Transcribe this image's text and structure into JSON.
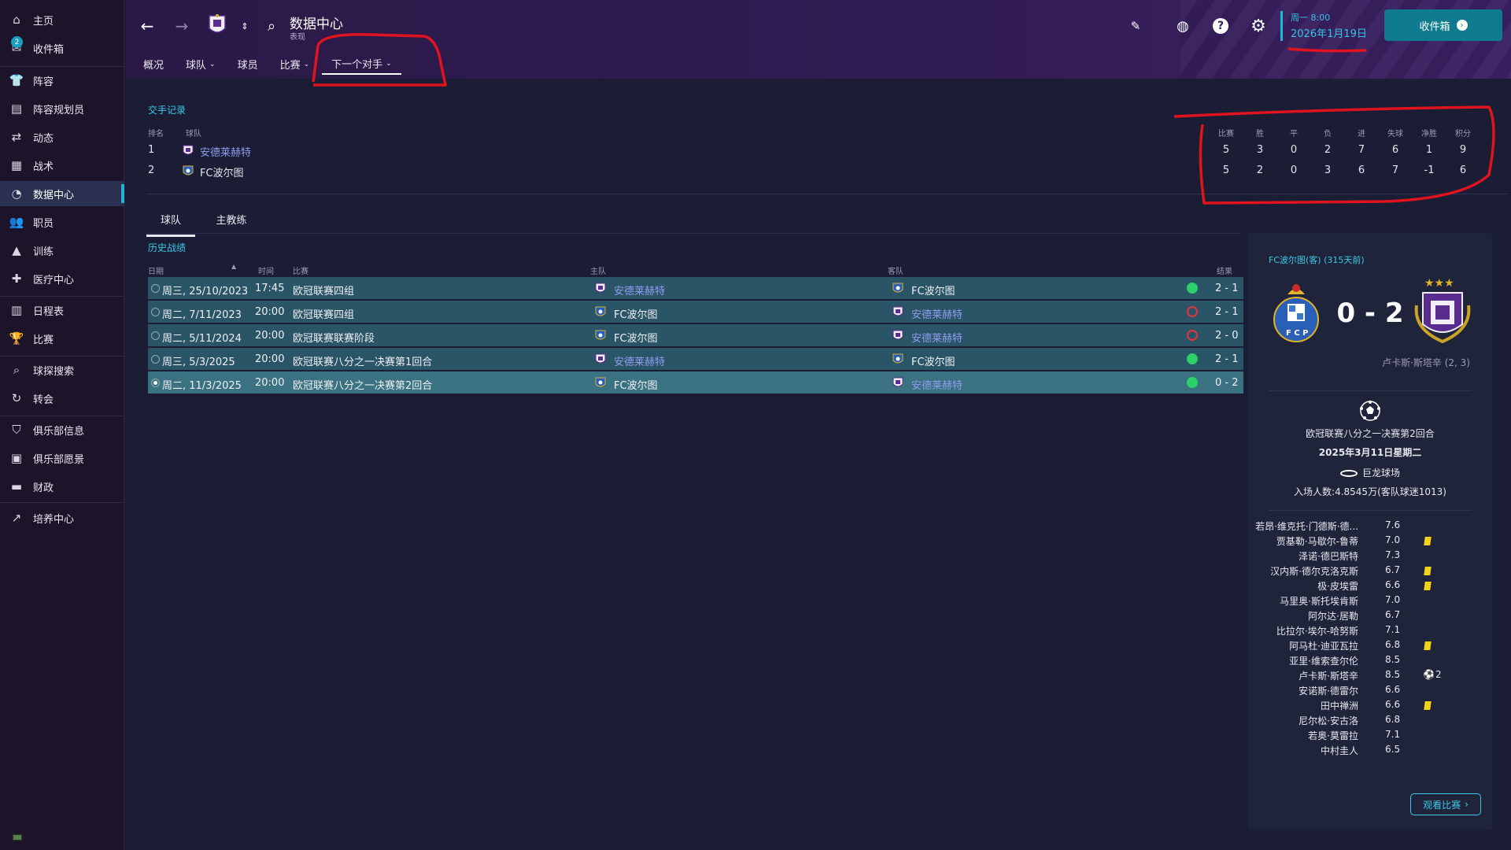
{
  "sidebar": {
    "items": [
      {
        "label": "主页",
        "icon": "home-icon"
      },
      {
        "label": "收件箱",
        "icon": "inbox-icon",
        "badge": "2"
      },
      {
        "label": "阵容",
        "icon": "shirt-icon"
      },
      {
        "label": "阵容规划员",
        "icon": "clipboard-icon"
      },
      {
        "label": "动态",
        "icon": "dynamics-icon"
      },
      {
        "label": "战术",
        "icon": "tactics-icon"
      },
      {
        "label": "数据中心",
        "icon": "data-hub-icon"
      },
      {
        "label": "职员",
        "icon": "staff-icon"
      },
      {
        "label": "训练",
        "icon": "training-icon"
      },
      {
        "label": "医疗中心",
        "icon": "medical-icon"
      },
      {
        "label": "日程表",
        "icon": "calendar-icon"
      },
      {
        "label": "比赛",
        "icon": "trophy-icon"
      },
      {
        "label": "球探搜索",
        "icon": "scouting-icon"
      },
      {
        "label": "转会",
        "icon": "transfers-icon"
      },
      {
        "label": "俱乐部信息",
        "icon": "shield-icon"
      },
      {
        "label": "俱乐部愿景",
        "icon": "vision-icon"
      },
      {
        "label": "财政",
        "icon": "finances-icon"
      },
      {
        "label": "培养中心",
        "icon": "development-icon"
      }
    ],
    "active_label": "数据中心"
  },
  "header": {
    "title": "数据中心",
    "subtitle": "表现",
    "subnav": [
      "概况",
      "球队",
      "球员",
      "比赛",
      "下一个对手"
    ],
    "date_time": "周一 8:00",
    "date": "2026年1月19日",
    "inbox_button": "收件箱"
  },
  "h2h": {
    "section_label": "交手记录",
    "columns_left": [
      "排名",
      "球队"
    ],
    "columns_right": [
      "比赛",
      "胜",
      "平",
      "负",
      "进",
      "失球",
      "净胜",
      "积分"
    ],
    "rows": [
      {
        "rank": "1",
        "team": "安德莱赫特",
        "stats": [
          "5",
          "3",
          "0",
          "2",
          "7",
          "6",
          "1",
          "9"
        ]
      },
      {
        "rank": "2",
        "team": "FC波尔图",
        "stats": [
          "5",
          "2",
          "0",
          "3",
          "6",
          "7",
          "-1",
          "6"
        ]
      }
    ]
  },
  "tabs": [
    "球队",
    "主教练"
  ],
  "history": {
    "section_label": "历史战绩",
    "columns": {
      "date": "日期",
      "time": "时间",
      "competition": "比赛",
      "home": "主队",
      "away": "客队",
      "result": "结果"
    },
    "rows": [
      {
        "date": "周三, 25/10/2023",
        "time": "17:45",
        "competition": "欧冠联赛四组",
        "home": "安德莱赫特",
        "away": "FC波尔图",
        "result": "2 - 1",
        "outcome": "win"
      },
      {
        "date": "周二, 7/11/2023",
        "time": "20:00",
        "competition": "欧冠联赛四组",
        "home": "FC波尔图",
        "away": "安德莱赫特",
        "result": "2 - 1",
        "outcome": "loss"
      },
      {
        "date": "周二, 5/11/2024",
        "time": "20:00",
        "competition": "欧冠联赛联赛阶段",
        "home": "FC波尔图",
        "away": "安德莱赫特",
        "result": "2 - 0",
        "outcome": "loss"
      },
      {
        "date": "周三, 5/3/2025",
        "time": "20:00",
        "competition": "欧冠联赛八分之一决赛第1回合",
        "home": "安德莱赫特",
        "away": "FC波尔图",
        "result": "2 - 1",
        "outcome": "win"
      },
      {
        "date": "周二, 11/3/2025",
        "time": "20:00",
        "competition": "欧冠联赛八分之一决赛第2回合",
        "home": "FC波尔图",
        "away": "安德莱赫特",
        "result": "0 - 2",
        "outcome": "win"
      }
    ]
  },
  "match": {
    "title": "FC波尔图(客) (315天前)",
    "score": "0 - 2",
    "scorer": "卢卡斯·斯塔辛 (2, 3)",
    "competition": "欧冠联赛八分之一决赛第2回合",
    "date": "2025年3月11日星期二",
    "stadium": "巨龙球场",
    "attendance": "入场人数:4.8545万(客队球迷1013)",
    "players": [
      {
        "name": "若昂·维克托·门德斯·德...",
        "rating": "7.6",
        "yellow": false
      },
      {
        "name": "贾基勒·马歇尔-鲁蒂",
        "rating": "7.0",
        "yellow": true
      },
      {
        "name": "泽诺·德巴斯特",
        "rating": "7.3",
        "yellow": false
      },
      {
        "name": "汉内斯·德尔克洛克斯",
        "rating": "6.7",
        "yellow": true
      },
      {
        "name": "极·皮埃雷",
        "rating": "6.6",
        "yellow": true
      },
      {
        "name": "马里奥·斯托埃肯斯",
        "rating": "7.0",
        "yellow": false
      },
      {
        "name": "阿尔达·居勒",
        "rating": "6.7",
        "yellow": false
      },
      {
        "name": "比拉尔·埃尔-哈努斯",
        "rating": "7.1",
        "yellow": false
      },
      {
        "name": "阿马杜·迪亚瓦拉",
        "rating": "6.8",
        "yellow": true
      },
      {
        "name": "亚里·维索查尔伦",
        "rating": "8.5",
        "yellow": false
      },
      {
        "name": "卢卡斯·斯塔辛",
        "rating": "8.5",
        "yellow": false,
        "goals": "2"
      },
      {
        "name": "安诺斯·德雷尔",
        "rating": "6.6",
        "yellow": false
      },
      {
        "name": "田中禅洲",
        "rating": "6.6",
        "yellow": true
      },
      {
        "name": "尼尔松·安古洛",
        "rating": "6.8",
        "yellow": false
      },
      {
        "name": "若奥·莫雷拉",
        "rating": "7.1",
        "yellow": false
      },
      {
        "name": "中村圭人",
        "rating": "6.5",
        "yellow": false
      }
    ],
    "watch_button": "观看比赛"
  },
  "colors": {
    "accent": "#21b6d6",
    "link": "#8f9cf0",
    "win": "#2ed06b",
    "loss": "#e5333f",
    "annotation": "#e0141e"
  }
}
